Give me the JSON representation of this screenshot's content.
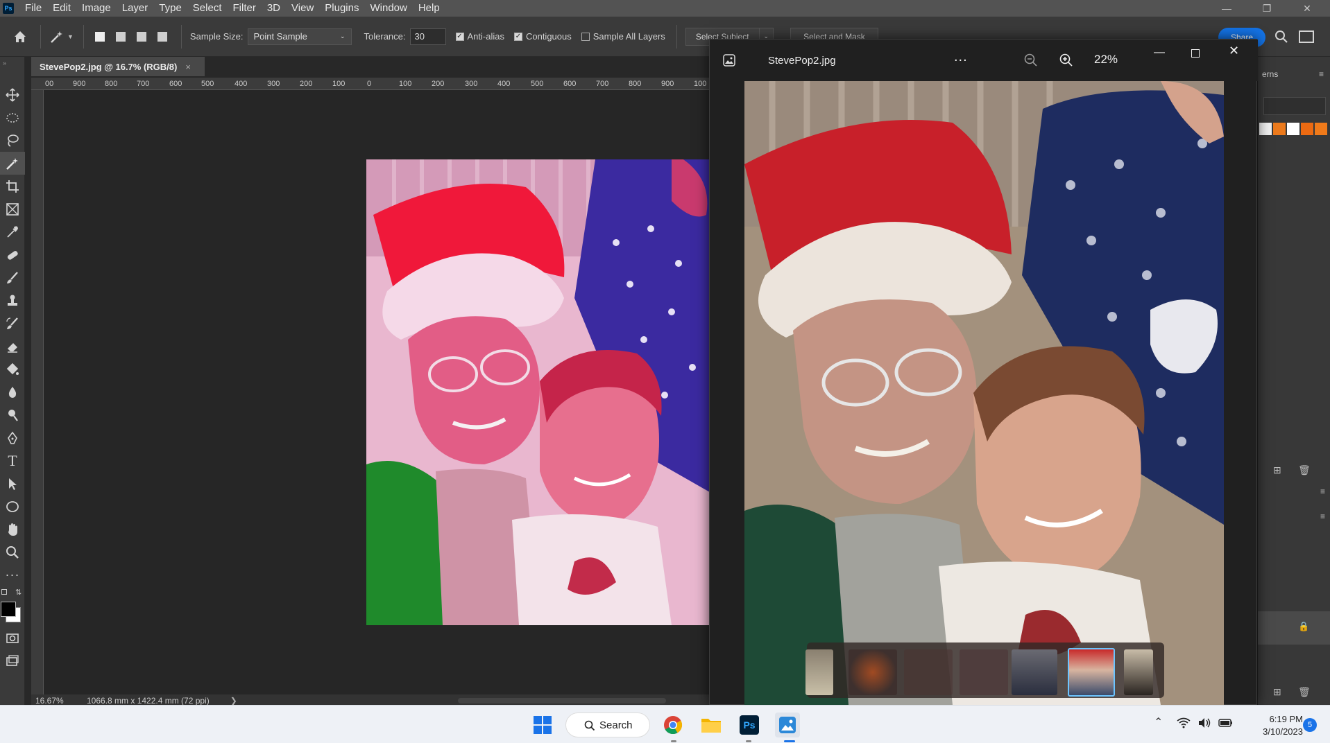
{
  "photoshop": {
    "logo": "Ps",
    "menu": [
      "File",
      "Edit",
      "Image",
      "Layer",
      "Type",
      "Select",
      "Filter",
      "3D",
      "View",
      "Plugins",
      "Window",
      "Help"
    ],
    "options": {
      "sample_size_label": "Sample Size:",
      "sample_size_value": "Point Sample",
      "tolerance_label": "Tolerance:",
      "tolerance_value": "30",
      "anti_alias_label": "Anti-alias",
      "anti_alias_checked": true,
      "contiguous_label": "Contiguous",
      "contiguous_checked": true,
      "sample_all_layers_label": "Sample All Layers",
      "sample_all_layers_checked": false,
      "select_subject_label": "Select Subject",
      "select_and_mask_label": "Select and Mask",
      "share_label": "Share"
    },
    "document_tab": {
      "title": "StevePop2.jpg @ 16.7% (RGB/8)",
      "close": "×"
    },
    "ruler_ticks": [
      "00",
      "900",
      "800",
      "700",
      "600",
      "500",
      "400",
      "300",
      "200",
      "100",
      "0",
      "100",
      "200",
      "300",
      "400",
      "500",
      "600",
      "700",
      "800",
      "900",
      "100"
    ],
    "status": {
      "zoom": "16.67%",
      "doc_size": "1066.8 mm x 1422.4 mm (72 ppi)"
    },
    "right_panel_label": "erns",
    "swatches": [
      "#f0f0f0",
      "#ec7a1c",
      "#ffffff",
      "#ec6a12",
      "#f07a1a"
    ]
  },
  "viewer": {
    "title": "StevePop2.jpg",
    "more": "...",
    "zoom": "22%"
  },
  "taskbar": {
    "search_label": "Search",
    "time": "6:19 PM",
    "date": "3/10/2023",
    "notification_count": "5"
  }
}
